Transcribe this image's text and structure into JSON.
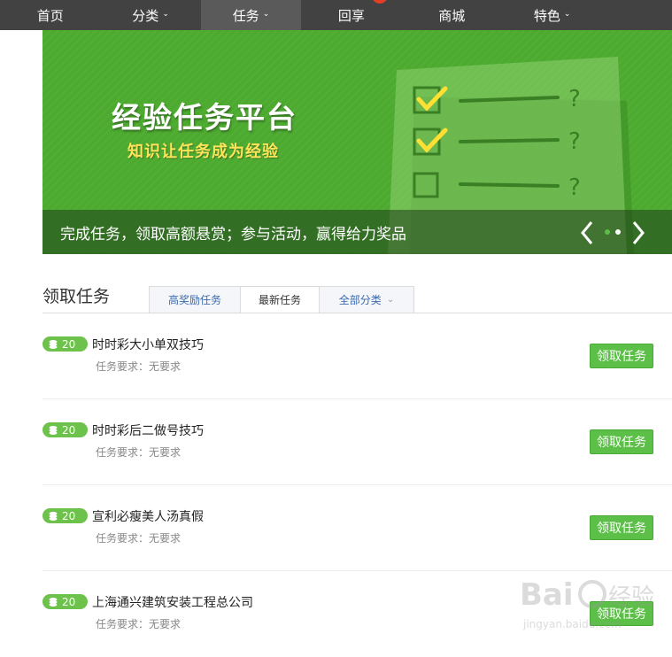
{
  "nav": {
    "items": [
      {
        "label": "首页",
        "dropdown": false
      },
      {
        "label": "分类",
        "dropdown": true
      },
      {
        "label": "任务",
        "dropdown": true,
        "active": true
      },
      {
        "label": "回享",
        "dropdown": false,
        "badge": true
      },
      {
        "label": "商城",
        "dropdown": false
      },
      {
        "label": "特色",
        "dropdown": true
      }
    ]
  },
  "banner": {
    "title": "经验任务平台",
    "subtitle": "知识让任务成为经验",
    "caption": "完成任务，领取高额悬赏；参与活动，赢得给力奖品",
    "prev_icon": "chevron-left-icon",
    "next_icon": "chevron-right-icon",
    "slide_count": 2,
    "active_slide": 0
  },
  "section": {
    "title": "领取任务",
    "tabs": [
      {
        "label": "高奖励任务",
        "active": false
      },
      {
        "label": "最新任务",
        "active": true
      },
      {
        "label": "全部分类",
        "active": false,
        "dropdown": true
      }
    ]
  },
  "tasks": [
    {
      "reward": "20",
      "title": "时时彩大小单双技巧",
      "requirement": "任务要求：无要求",
      "button": "领取任务"
    },
    {
      "reward": "20",
      "title": "时时彩后二做号技巧",
      "requirement": "任务要求：无要求",
      "button": "领取任务"
    },
    {
      "reward": "20",
      "title": "宣利必瘦美人汤真假",
      "requirement": "任务要求：无要求",
      "button": "领取任务"
    },
    {
      "reward": "20",
      "title": "上海通兴建筑安装工程总公司",
      "requirement": "任务要求：无要求",
      "button": "领取任务"
    }
  ],
  "colors": {
    "nav_bg": "#424242",
    "banner_green": "#4caa2f",
    "accent_green": "#5cbf47",
    "subtitle_yellow": "#ffe45a",
    "tab_link_blue": "#3a6ab0"
  },
  "watermark": {
    "text": "Baidu 经验",
    "url": "jingyan.baidu.com"
  }
}
